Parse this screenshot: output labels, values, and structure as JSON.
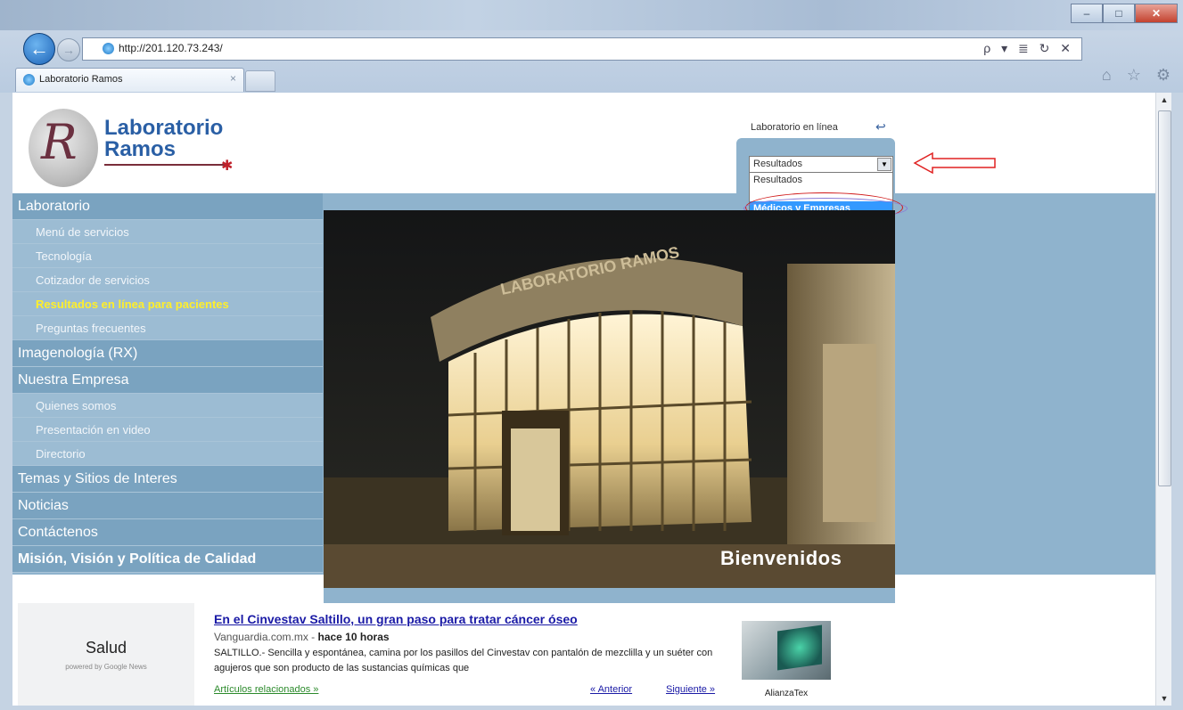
{
  "browser": {
    "url": "http://201.120.73.243/",
    "tab_title": "Laboratorio Ramos",
    "tab_close": "×",
    "back": "←",
    "forward": "→",
    "addr_tools": "ρ ▾ ≣ ↻ ✕",
    "fav_icons": "⌂ ☆ ⚙"
  },
  "header": {
    "logo_line1": "Laboratorio",
    "logo_line2": "Ramos",
    "online_label": "Laboratorio en línea",
    "select_value": "Resultados",
    "dropdown_options": [
      "Resultados",
      "",
      "Médicos y Empresas"
    ],
    "selected_option_index": 2
  },
  "nav": [
    {
      "label": "Laboratorio",
      "type": "main"
    },
    {
      "label": "Menú de servicios",
      "type": "sub"
    },
    {
      "label": "Tecnología",
      "type": "sub"
    },
    {
      "label": "Cotizador de servicios",
      "type": "sub"
    },
    {
      "label": "Resultados en línea para pacientes",
      "type": "sub",
      "highlight": true
    },
    {
      "label": "Preguntas frecuentes",
      "type": "sub"
    },
    {
      "label": "Imagenología (RX)",
      "type": "main"
    },
    {
      "label": "Nuestra Empresa",
      "type": "main"
    },
    {
      "label": "Quienes somos",
      "type": "sub"
    },
    {
      "label": "Presentación en video",
      "type": "sub"
    },
    {
      "label": "Directorio",
      "type": "sub"
    },
    {
      "label": "Temas y Sitios de Interes",
      "type": "main"
    },
    {
      "label": "Noticias",
      "type": "main"
    },
    {
      "label": "Contáctenos",
      "type": "main"
    },
    {
      "label": "Misión, Visión y Política de Calidad",
      "type": "main",
      "bold": true
    }
  ],
  "hero": {
    "building_sign": "LABORATORIO RAMOS",
    "welcome": "Bienvenidos"
  },
  "news": {
    "widget_title": "Salud",
    "powered_by": "powered by Google News",
    "headline": "En el Cinvestav Saltillo, un gran paso para tratar cáncer óseo",
    "source": "Vanguardia.com.mx",
    "age": "hace 10 horas",
    "snippet": "SALTILLO.- Sencilla y espontánea, camina por los pasillos del Cinvestav con pantalón de mezclilla y un suéter con agujeros que son producto de las sustancias químicas que",
    "related": "Artículos relacionados »",
    "prev": "« Anterior",
    "next": "Siguiente »",
    "thumb_caption": "AlianzaTex"
  },
  "colors": {
    "nav_blue": "#7aa3c0",
    "band_blue": "#8fb3cd",
    "highlight_yellow": "#ffef2a",
    "logo_blue": "#2a5fa5"
  }
}
